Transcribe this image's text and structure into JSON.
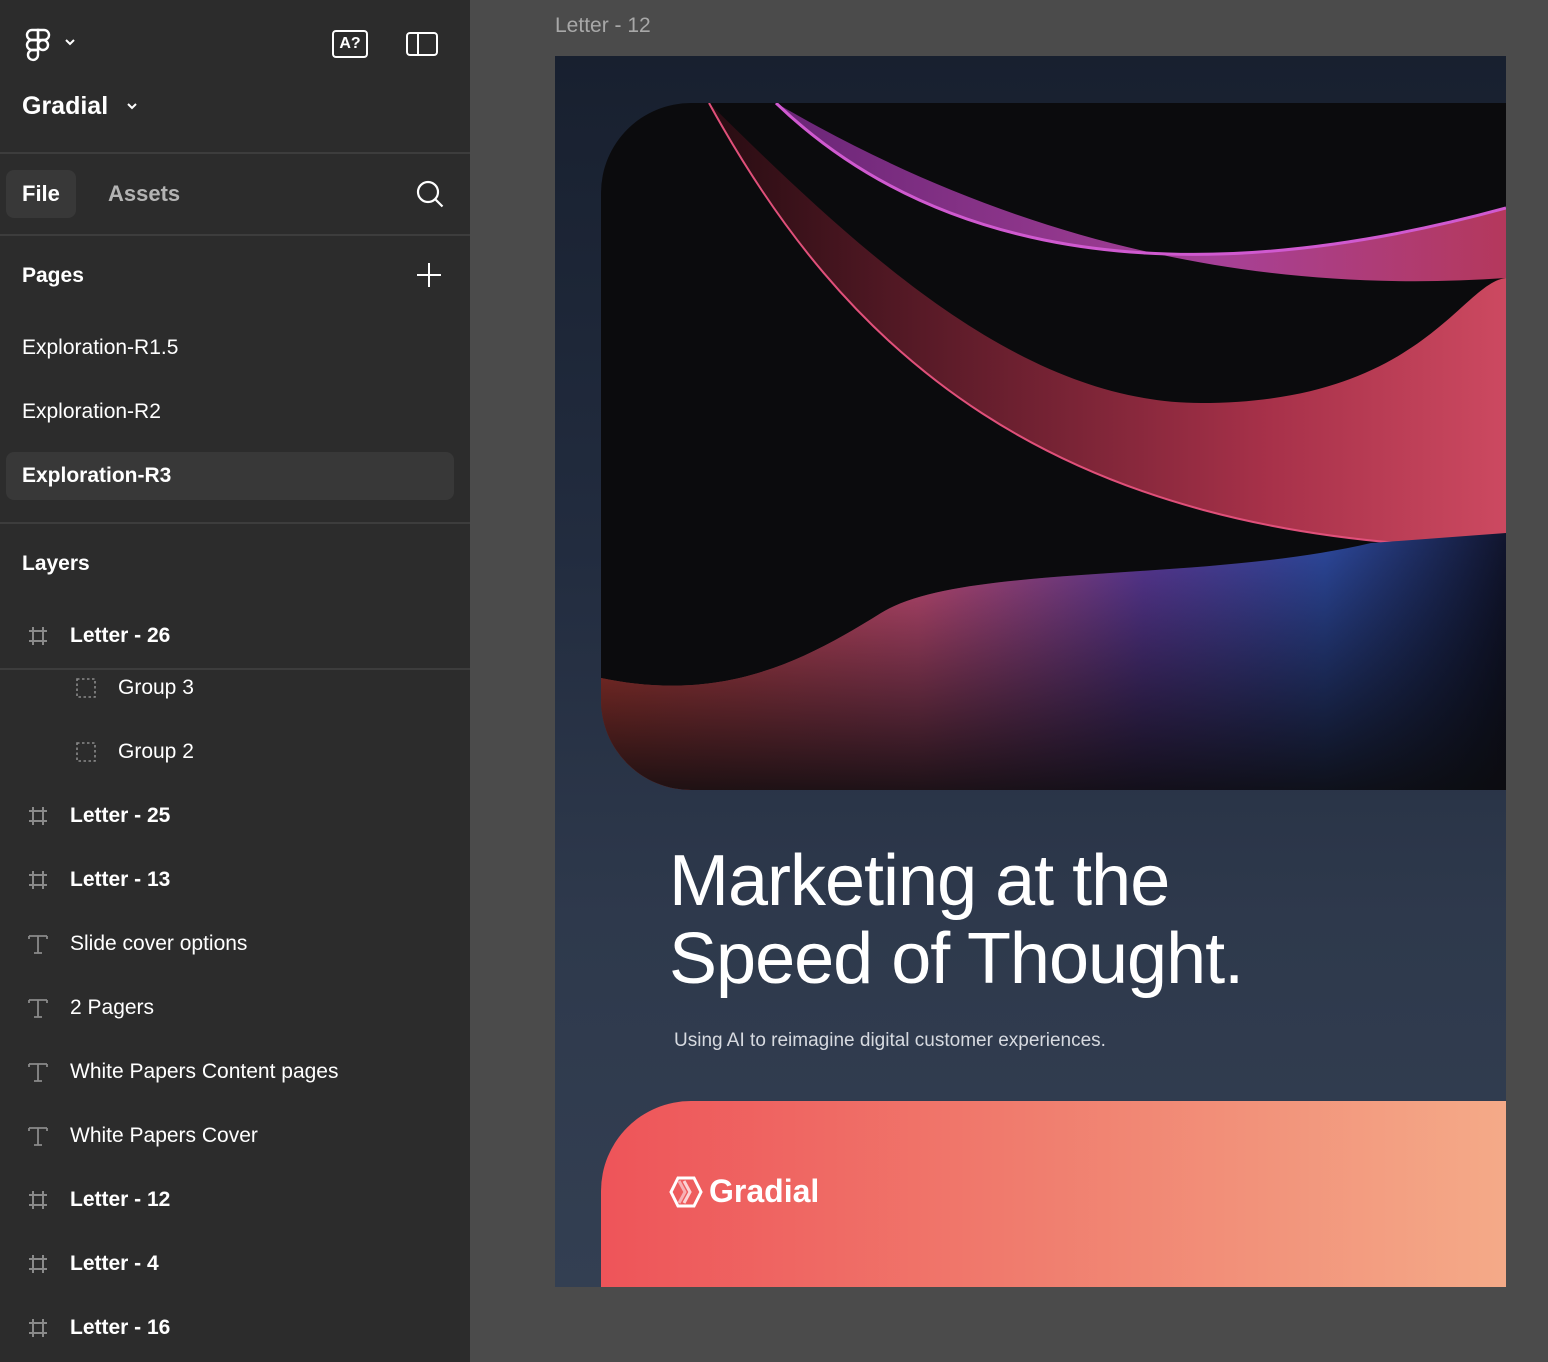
{
  "app": {
    "logo_icon": "figma-logo-icon",
    "ai_button_label": "A?",
    "panel_toggle_icon": "sidebar-panel-icon"
  },
  "project": {
    "name": "Gradial"
  },
  "tabs": [
    {
      "label": "File",
      "active": true
    },
    {
      "label": "Assets",
      "active": false
    }
  ],
  "pages": {
    "heading": "Pages",
    "items": [
      {
        "label": "Exploration-R1.5",
        "selected": false
      },
      {
        "label": "Exploration-R2",
        "selected": false
      },
      {
        "label": "Exploration-R3",
        "selected": true
      }
    ]
  },
  "layers": {
    "heading": "Layers",
    "items": [
      {
        "type": "frame",
        "label": "Letter - 26"
      },
      {
        "type": "group",
        "label": "Group 3"
      },
      {
        "type": "group",
        "label": "Group 2"
      },
      {
        "type": "frame",
        "label": "Letter - 25"
      },
      {
        "type": "frame",
        "label": "Letter - 13"
      },
      {
        "type": "text",
        "label": "Slide cover options"
      },
      {
        "type": "text",
        "label": "2 Pagers"
      },
      {
        "type": "text",
        "label": "White Papers Content pages"
      },
      {
        "type": "text",
        "label": "White Papers Cover"
      },
      {
        "type": "frame",
        "label": "Letter - 12"
      },
      {
        "type": "frame",
        "label": "Letter - 4"
      },
      {
        "type": "frame",
        "label": "Letter - 16"
      }
    ]
  },
  "canvas": {
    "frame_label": "Letter - 12",
    "headline_line1": "Marketing at the",
    "headline_line2": "Speed of Thought.",
    "subline": "Using AI to reimagine digital customer experiences.",
    "brand_name": "Gradial",
    "colors": {
      "panel_bg": "#2c2c2c",
      "canvas_bg": "#4b4b4b",
      "artboard_bg": "#2e394c",
      "band_start": "#ee5459",
      "band_end": "#f4aa88"
    }
  }
}
